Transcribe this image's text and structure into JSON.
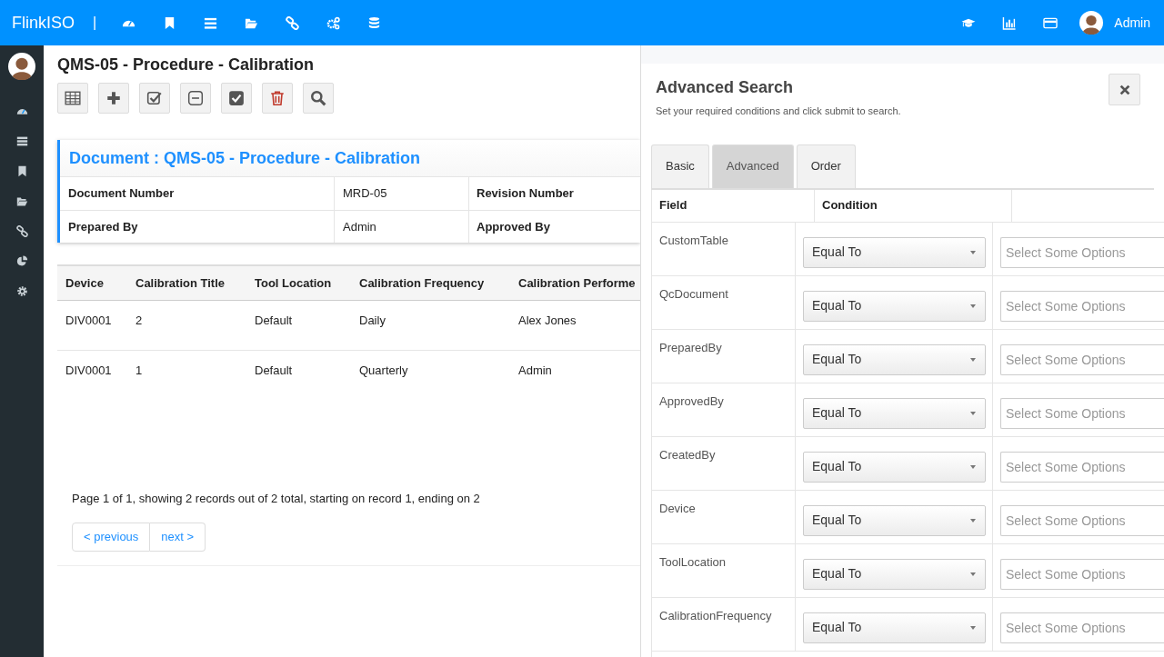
{
  "app": {
    "brand": "FlinkISO",
    "separator": "|",
    "user": "Admin"
  },
  "page_title": "QMS-05 - Procedure - Calibration",
  "document": {
    "title": "Document : QMS-05 - Procedure - Calibration",
    "rows": [
      {
        "label": "Document Number",
        "value": "MRD-05",
        "label_2": "Revision Number"
      },
      {
        "label": "Prepared By",
        "value": "Admin",
        "label_2": "Approved By"
      }
    ]
  },
  "records": {
    "columns": [
      "Device",
      "Calibration Title",
      "Tool Location",
      "Calibration Frequency",
      "Calibration Performe"
    ],
    "rows": [
      [
        "DIV0001",
        "2",
        "Default",
        "Daily",
        "Alex Jones"
      ],
      [
        "DIV0001",
        "1",
        "Default",
        "Quarterly",
        "Admin"
      ]
    ]
  },
  "pagination": {
    "summary": "Page 1 of 1, showing 2 records out of 2 total, starting on record 1, ending on 2",
    "buttons": [
      "< previous",
      "next >"
    ]
  },
  "search_panel": {
    "title": "Advanced Search",
    "subtitle": "Set your required conditions and click submit to search.",
    "tabs": [
      {
        "label": "Basic",
        "selected": false
      },
      {
        "label": "Advanced",
        "selected": true
      },
      {
        "label": "Order",
        "selected": false
      }
    ],
    "columns": [
      "Field",
      "Condition"
    ],
    "rows": [
      {
        "field": "CustomTable",
        "condition": "Equal To",
        "placeholder": "Select Some Options"
      },
      {
        "field": "QcDocument",
        "condition": "Equal To",
        "placeholder": "Select Some Options"
      },
      {
        "field": "PreparedBy",
        "condition": "Equal To",
        "placeholder": "Select Some Options"
      },
      {
        "field": "ApprovedBy",
        "condition": "Equal To",
        "placeholder": "Select Some Options"
      },
      {
        "field": "CreatedBy",
        "condition": "Equal To",
        "placeholder": "Select Some Options"
      },
      {
        "field": "Device",
        "condition": "Equal To",
        "placeholder": "Select Some Options"
      },
      {
        "field": "ToolLocation",
        "condition": "Equal To",
        "placeholder": "Select Some Options"
      },
      {
        "field": "CalibrationFrequency",
        "condition": "Equal To",
        "placeholder": "Select Some Options"
      }
    ]
  }
}
